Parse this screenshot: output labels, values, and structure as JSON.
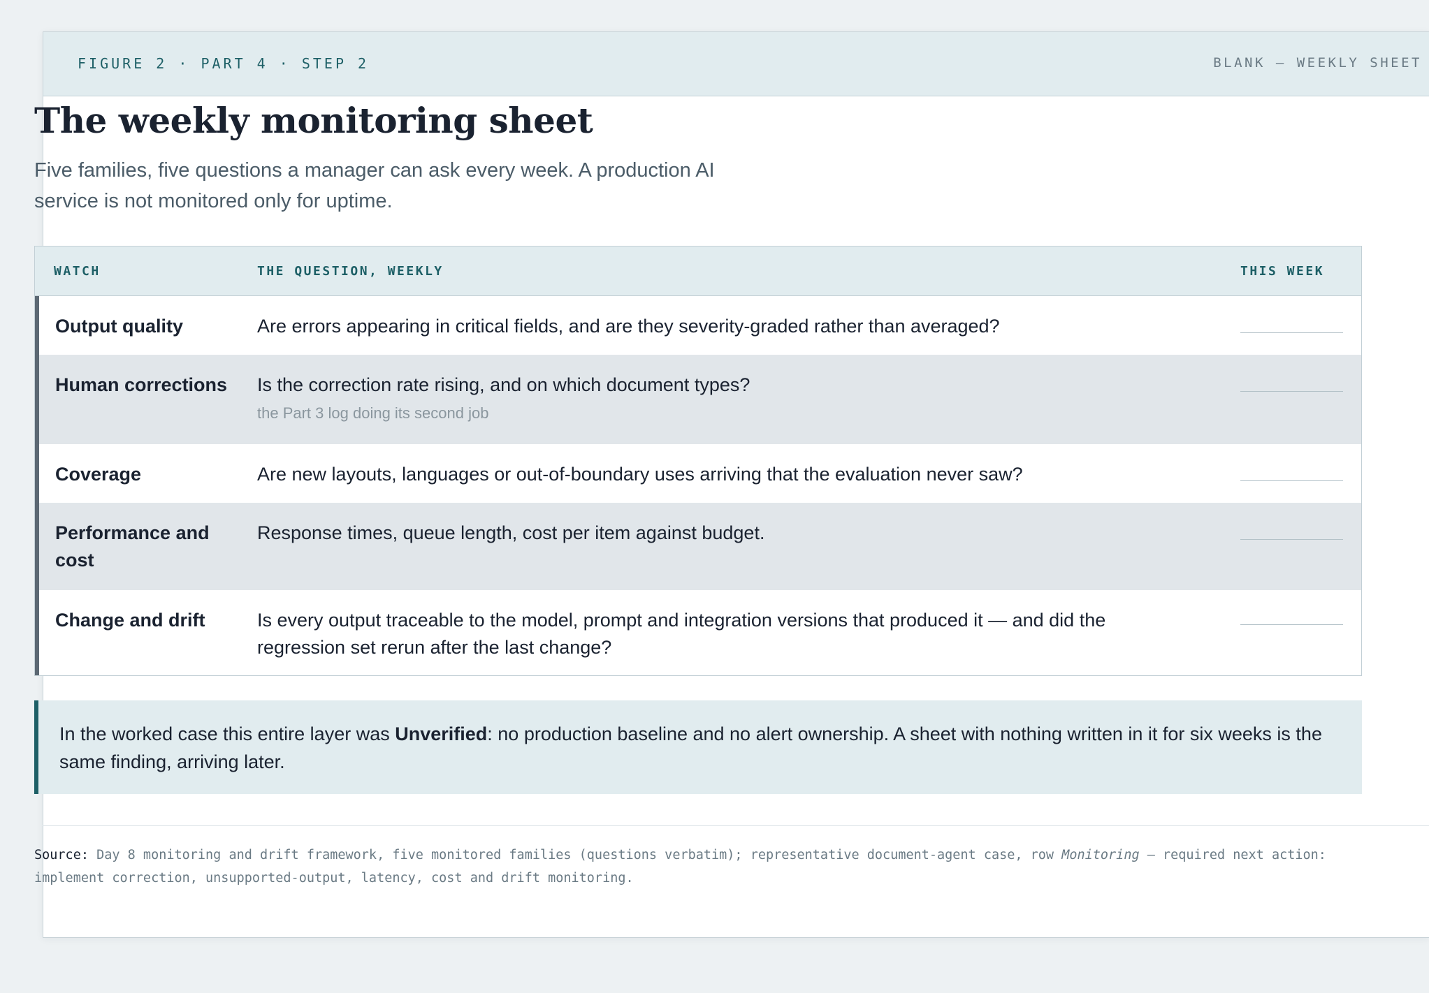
{
  "header": {
    "figure_label": "FIGURE 2 · PART 4 · STEP 2",
    "sheet_label": "BLANK — WEEKLY SHEET"
  },
  "title": "The weekly monitoring sheet",
  "subtitle": "Five families, five questions a manager can ask every week. A production AI service is not monitored only for uptime.",
  "table": {
    "columns": [
      "WATCH",
      "THE QUESTION, WEEKLY",
      "THIS WEEK"
    ],
    "rows": [
      {
        "watch": "Output quality",
        "question": "Are errors appearing in critical fields, and are they severity-graded rather than averaged?",
        "note": "",
        "this_week": ""
      },
      {
        "watch": "Human corrections",
        "question": "Is the correction rate rising, and on which document types?",
        "note": "the Part 3 log doing its second job",
        "this_week": ""
      },
      {
        "watch": "Coverage",
        "question": "Are new layouts, languages or out-of-boundary uses arriving that the evaluation never saw?",
        "note": "",
        "this_week": ""
      },
      {
        "watch": "Performance and cost",
        "question": "Response times, queue length, cost per item against budget.",
        "note": "",
        "this_week": ""
      },
      {
        "watch": "Change and drift",
        "question": "Is every output traceable to the model, prompt and integration versions that produced it — and did the regression set rerun after the last change?",
        "note": "",
        "this_week": ""
      }
    ]
  },
  "callout": {
    "before": "In the worked case this entire layer was ",
    "bold": "Unverified",
    "after": ": no production baseline and no alert ownership. A sheet with nothing written in it for six weeks is the same finding, arriving later."
  },
  "footer": {
    "label": "Source:",
    "text_before": " Day 8 monitoring and drift framework, five monitored families (questions verbatim); representative document-agent case, row ",
    "italic": "Monitoring",
    "text_after": " — required next action: implement correction, unsupported-output, latency, cost and drift monitoring."
  }
}
